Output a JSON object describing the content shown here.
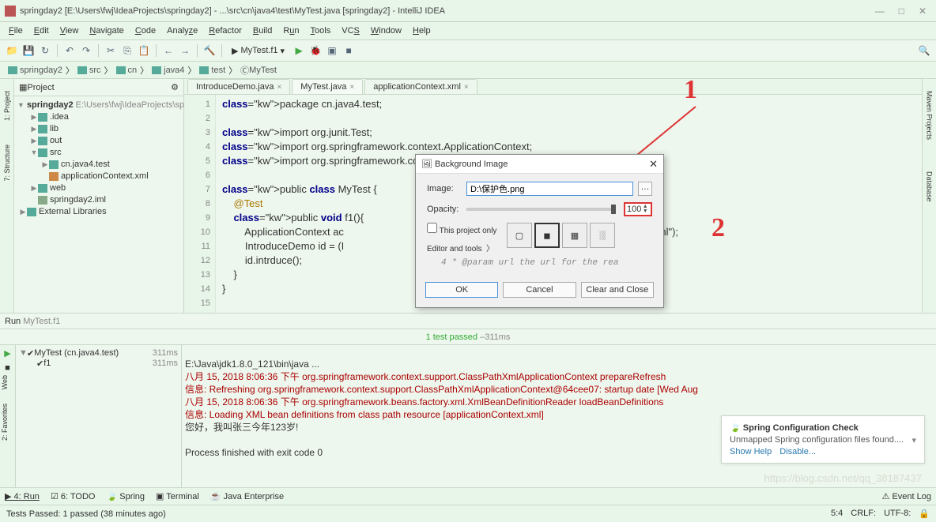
{
  "window": {
    "title": "springday2 [E:\\Users\\fwj\\IdeaProjects\\springday2] - ...\\src\\cn\\java4\\test\\MyTest.java [springday2] - IntelliJ IDEA"
  },
  "menu": [
    "File",
    "Edit",
    "View",
    "Navigate",
    "Code",
    "Analyze",
    "Refactor",
    "Build",
    "Run",
    "Tools",
    "VCS",
    "Window",
    "Help"
  ],
  "run_config": "MyTest.f1",
  "breadcrumb": [
    "springday2",
    "src",
    "cn",
    "java4",
    "test",
    "MyTest"
  ],
  "project_panel": {
    "title": "Project"
  },
  "tree": {
    "root": "springday2",
    "root_path": "E:\\Users\\fwj\\IdeaProjects\\spr",
    "nodes": [
      {
        "label": ".idea",
        "indent": 1,
        "arrow": "▶",
        "type": "folder"
      },
      {
        "label": "lib",
        "indent": 1,
        "arrow": "▶",
        "type": "folder"
      },
      {
        "label": "out",
        "indent": 1,
        "arrow": "▶",
        "type": "folder"
      },
      {
        "label": "src",
        "indent": 1,
        "arrow": "▼",
        "type": "folder"
      },
      {
        "label": "cn.java4.test",
        "indent": 2,
        "arrow": "▶",
        "type": "folder"
      },
      {
        "label": "applicationContext.xml",
        "indent": 2,
        "arrow": "",
        "type": "xml"
      },
      {
        "label": "web",
        "indent": 1,
        "arrow": "▶",
        "type": "folder"
      },
      {
        "label": "springday2.iml",
        "indent": 1,
        "arrow": "",
        "type": "file"
      },
      {
        "label": "External Libraries",
        "indent": 0,
        "arrow": "▶",
        "type": "folder"
      }
    ]
  },
  "tabs": [
    {
      "label": "IntroduceDemo.java",
      "active": false
    },
    {
      "label": "MyTest.java",
      "active": true
    },
    {
      "label": "applicationContext.xml",
      "active": false
    }
  ],
  "code": {
    "lines": [
      "package cn.java4.test;",
      "",
      "import org.junit.Test;",
      "import org.springframework.context.ApplicationContext;",
      "import org.springframework.context.support.ClassPathXmlApplicationContext;",
      "",
      "public class MyTest {",
      "    @Test",
      "    public void f1(){",
      "        ApplicationContext ac                                   nfigLocation: \"applicationContext.xml\");",
      "        IntroduceDemo id = (I                                   o\");",
      "        id.intrduce();",
      "    }",
      "}",
      ""
    ],
    "line_numbers": [
      "1",
      "2",
      "3",
      "4",
      "5",
      "6",
      "7",
      "8",
      "9",
      "10",
      "11",
      "12",
      "13",
      "14",
      "15"
    ]
  },
  "run": {
    "label": "Run",
    "config": "MyTest.f1",
    "test_status": "1 test passed",
    "test_time": "311ms",
    "tree_root": "MyTest (cn.java4.test)",
    "tree_root_time": "311ms",
    "tree_test": "f1",
    "tree_test_time": "311ms"
  },
  "console": {
    "l1": "E:\\Java\\jdk1.8.0_121\\bin\\java ...",
    "l2": "八月 15, 2018 8:06:36 下午 org.springframework.context.support.ClassPathXmlApplicationContext prepareRefresh",
    "l3": "信息: Refreshing org.springframework.context.support.ClassPathXmlApplicationContext@64cee07: startup date [Wed Aug",
    "l4": "八月 15, 2018 8:06:36 下午 org.springframework.beans.factory.xml.XmlBeanDefinitionReader loadBeanDefinitions",
    "l5": "信息: Loading XML bean definitions from class path resource [applicationContext.xml]",
    "l6": "您好，我叫张三今年123岁!",
    "l7": "",
    "l8": "Process finished with exit code 0"
  },
  "dialog": {
    "title": "Background Image",
    "image_label": "Image:",
    "image_value": "D:\\保护色.png",
    "opacity_label": "Opacity:",
    "opacity_value": "100",
    "project_only": "This project only",
    "editor_tools": "Editor and tools",
    "preview": "4  * @param url the url for the rea",
    "ok": "OK",
    "cancel": "Cancel",
    "clear": "Clear and Close"
  },
  "notification": {
    "title": "Spring Configuration Check",
    "body": "Unmapped Spring configuration files found....",
    "show_help": "Show Help",
    "disable": "Disable..."
  },
  "bottom": {
    "run": "4: Run",
    "todo": "6: TODO",
    "spring": "Spring",
    "terminal": "Terminal",
    "jee": "Java Enterprise",
    "event": "Event Log"
  },
  "status": {
    "left": "Tests Passed: 1 passed (38 minutes ago)",
    "pos": "5:4",
    "crlf": "CRLF:",
    "enc": "UTF-8:"
  },
  "left_tabs": [
    "1: Project",
    "7: Structure"
  ],
  "right_tabs": [
    "Maven Projects",
    "Database"
  ],
  "left_tabs_lower": [
    "Web",
    "2: Favorites"
  ]
}
